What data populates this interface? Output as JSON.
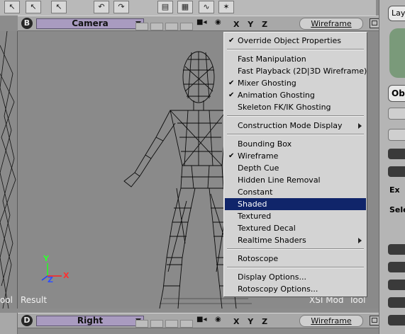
{
  "top_viewport": {
    "letter": "B",
    "camera": "Camera",
    "axes": "X Y Z",
    "mode": "Wireframe"
  },
  "bottom_viewport": {
    "letter": "D",
    "camera": "Right",
    "axes": "X Y Z",
    "mode": "Wireframe"
  },
  "viewport_overlay": {
    "result_label": "Result",
    "engine_label": "XSI Mod  Tool",
    "left_label": "ool",
    "axis_y": "Y",
    "axis_x": "X",
    "axis_z": "Z"
  },
  "right_panel": {
    "items": [
      "Lay",
      "Ob",
      "Ex",
      "Sele"
    ]
  },
  "menu": {
    "items": [
      {
        "label": "Override Object Properties",
        "checked": true,
        "submenu": false
      },
      {
        "label": "Fast Manipulation",
        "checked": false,
        "submenu": false
      },
      {
        "label": "Fast Playback (2D|3D Wireframe)",
        "checked": false,
        "submenu": false
      },
      {
        "label": "Mixer Ghosting",
        "checked": true,
        "submenu": false
      },
      {
        "label": "Animation Ghosting",
        "checked": true,
        "submenu": false
      },
      {
        "label": "Skeleton FK/IK Ghosting",
        "checked": false,
        "submenu": false
      },
      {
        "label": "Construction Mode Display",
        "checked": false,
        "submenu": true
      },
      {
        "label": "Bounding Box",
        "checked": false,
        "submenu": false
      },
      {
        "label": "Wireframe",
        "checked": true,
        "submenu": false
      },
      {
        "label": "Depth Cue",
        "checked": false,
        "submenu": false
      },
      {
        "label": "Hidden Line Removal",
        "checked": false,
        "submenu": false
      },
      {
        "label": "Constant",
        "checked": false,
        "submenu": false
      },
      {
        "label": "Shaded",
        "checked": false,
        "submenu": false,
        "highlighted": true
      },
      {
        "label": "Textured",
        "checked": false,
        "submenu": false
      },
      {
        "label": "Textured Decal",
        "checked": false,
        "submenu": false
      },
      {
        "label": "Realtime Shaders",
        "checked": false,
        "submenu": true
      },
      {
        "label": "Rotoscope",
        "checked": false,
        "submenu": false
      },
      {
        "label": "Display Options...",
        "checked": false,
        "submenu": false
      },
      {
        "label": "Rotoscopy Options...",
        "checked": false,
        "submenu": false
      }
    ]
  },
  "colors": {
    "menu_highlight": "#10256a",
    "camera_selector": "#a99bc0",
    "viewport_bg": "#8a8a8a",
    "axis_x": "#ff2020",
    "axis_y": "#20ff20",
    "axis_z": "#2040ff"
  }
}
